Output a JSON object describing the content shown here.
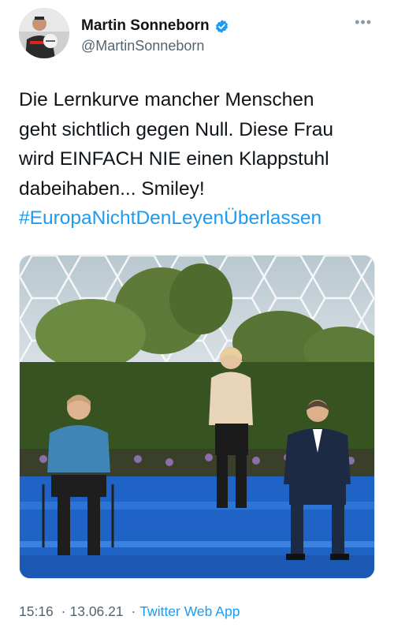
{
  "author": {
    "display_name": "Martin Sonneborn",
    "handle": "@MartinSonneborn",
    "verified": true
  },
  "tweet": {
    "text": "Die Lernkurve mancher Menschen\ngeht sichtlich gegen Null. Diese Frau\nwird EINFACH NIE einen Klappstuhl\ndabeihaben... Smiley!",
    "hashtag": "#EuropaNichtDenLeyenÜberlassen"
  },
  "meta": {
    "time": "15:16",
    "date": "13.06.21",
    "separator": "·",
    "source": "Twitter Web App"
  },
  "colors": {
    "accent": "#1d9bf0",
    "text": "#0f1419",
    "muted": "#536471"
  },
  "icons": {
    "verified": "verified-badge-icon",
    "more": "more-options-icon"
  }
}
